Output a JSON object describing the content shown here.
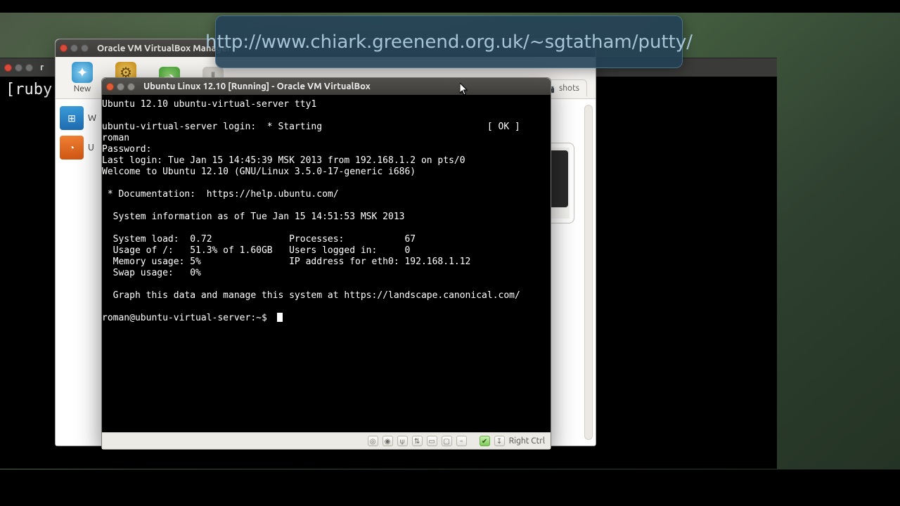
{
  "overlay_url": "http://www.chiark.greenend.org.uk/~sgtatham/putty/",
  "bg_term": {
    "title": "r",
    "body_line": "[ruby-"
  },
  "vbm": {
    "title": "Oracle VM VirtualBox Manager",
    "toolbar": {
      "new_label": "New",
      "settings_label": "Se",
      "start_label": "",
      "discard_label": ""
    },
    "vms": [
      {
        "label": "W"
      },
      {
        "label": "U"
      }
    ],
    "snapshots_tab": "shots"
  },
  "vmw": {
    "title": "Ubuntu Linux 12.10 [Running] - Oracle VM VirtualBox",
    "lines": [
      "Ubuntu 12.10 ubuntu-virtual-server tty1",
      "",
      "ubuntu-virtual-server login:  * Starting                              [ OK ]",
      "roman",
      "Password:",
      "Last login: Tue Jan 15 14:45:39 MSK 2013 from 192.168.1.2 on pts/0",
      "Welcome to Ubuntu 12.10 (GNU/Linux 3.5.0-17-generic i686)",
      "",
      " * Documentation:  https://help.ubuntu.com/",
      "",
      "  System information as of Tue Jan 15 14:51:53 MSK 2013",
      "",
      "  System load:  0.72              Processes:           67",
      "  Usage of /:   51.3% of 1.60GB   Users logged in:     0",
      "  Memory usage: 5%                IP address for eth0: 192.168.1.12",
      "  Swap usage:   0%",
      "",
      "  Graph this data and manage this system at https://landscape.canonical.com/",
      "",
      "roman@ubuntu-virtual-server:~$ "
    ],
    "status": {
      "host_key": "Right Ctrl"
    }
  }
}
